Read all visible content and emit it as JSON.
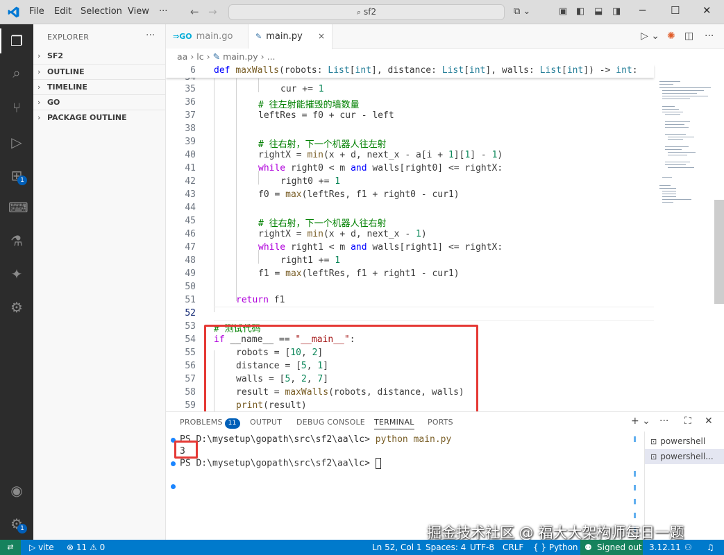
{
  "titlebar": {
    "menu": [
      "File",
      "Edit",
      "Selection",
      "View",
      "···"
    ],
    "search": "sf2"
  },
  "activity": {
    "icons": [
      "explorer-icon",
      "search-icon",
      "source-control-icon",
      "run-debug-icon",
      "extensions-icon",
      "remote-explorer-icon",
      "testing-icon",
      "chat-icon",
      "docker-icon",
      "accounts-icon",
      "manage-icon"
    ],
    "extensions_badge": "1",
    "manage_badge": "1"
  },
  "sidebar": {
    "title": "EXPLORER",
    "more": "···",
    "sections": [
      "SF2",
      "OUTLINE",
      "TIMELINE",
      "GO",
      "PACKAGE OUTLINE"
    ]
  },
  "tabs": [
    {
      "label": "main.go",
      "icon": "GO",
      "active": false
    },
    {
      "label": "main.py",
      "icon": "py",
      "active": true,
      "close": "×"
    }
  ],
  "breadcrumb": {
    "parts": [
      "aa",
      "lc",
      "main.py",
      "..."
    ]
  },
  "editor": {
    "sticky": {
      "num": "6",
      "text": "def maxWalls(robots: List[int], distance: List[int], walls: List[int]) -> int:"
    },
    "lines": [
      {
        "num": "35",
        "text": "cur += 1"
      },
      {
        "num": "36",
        "text": "# 往左射能摧毁的墙数量"
      },
      {
        "num": "37",
        "text": "leftRes = f0 + cur - left"
      },
      {
        "num": "38",
        "text": ""
      },
      {
        "num": "39",
        "text": "# 往右射，下一个机器人往左射"
      },
      {
        "num": "40",
        "text": "rightX = min(x + d, next_x - a[i + 1][1] - 1)"
      },
      {
        "num": "41",
        "text": "while right0 < m and walls[right0] <= rightX:"
      },
      {
        "num": "42",
        "text": "right0 += 1"
      },
      {
        "num": "43",
        "text": "f0 = max(leftRes, f1 + right0 - cur1)"
      },
      {
        "num": "44",
        "text": ""
      },
      {
        "num": "45",
        "text": "# 往右射，下一个机器人往右射"
      },
      {
        "num": "46",
        "text": "rightX = min(x + d, next_x - 1)"
      },
      {
        "num": "47",
        "text": "while right1 < m and walls[right1] <= rightX:"
      },
      {
        "num": "48",
        "text": "right1 += 1"
      },
      {
        "num": "49",
        "text": "f1 = max(leftRes, f1 + right1 - cur1)"
      },
      {
        "num": "50",
        "text": ""
      },
      {
        "num": "51",
        "text": "return f1"
      },
      {
        "num": "52",
        "text": ""
      },
      {
        "num": "53",
        "text": "# 测试代码"
      },
      {
        "num": "54",
        "text": "if __name__ == \"__main__\":"
      },
      {
        "num": "55",
        "text": "robots = [10, 2]"
      },
      {
        "num": "56",
        "text": "distance = [5, 1]"
      },
      {
        "num": "57",
        "text": "walls = [5, 2, 7]"
      },
      {
        "num": "58",
        "text": "result = maxWalls(robots, distance, walls)"
      },
      {
        "num": "59",
        "text": "print(result)"
      }
    ]
  },
  "panel": {
    "tabs": [
      "PROBLEMS",
      "OUTPUT",
      "DEBUG CONSOLE",
      "TERMINAL",
      "PORTS"
    ],
    "problems_count": "11",
    "terminal": {
      "prompt1": "PS D:\\mysetup\\gopath\\src\\sf2\\aa\\lc> ",
      "command": "python main.py",
      "output": "3",
      "prompt2": "PS D:\\mysetup\\gopath\\src\\sf2\\aa\\lc> "
    },
    "terminals": [
      "powershell",
      "powershell..."
    ]
  },
  "watermark": "掘金技术社区 @ 福大大架构师每日一题",
  "status": {
    "vite": "vite",
    "errors": "11",
    "warnings": "0",
    "position": "Ln 52, Col 1",
    "spaces": "Spaces: 4",
    "encoding": "UTF-8",
    "eol": "CRLF",
    "language": "Python",
    "signed": "Signed out",
    "version": "3.12.11"
  },
  "colors": {
    "statusbar": "#007acc",
    "activitybar": "#2c2c2c",
    "highlight": "#e53935"
  }
}
